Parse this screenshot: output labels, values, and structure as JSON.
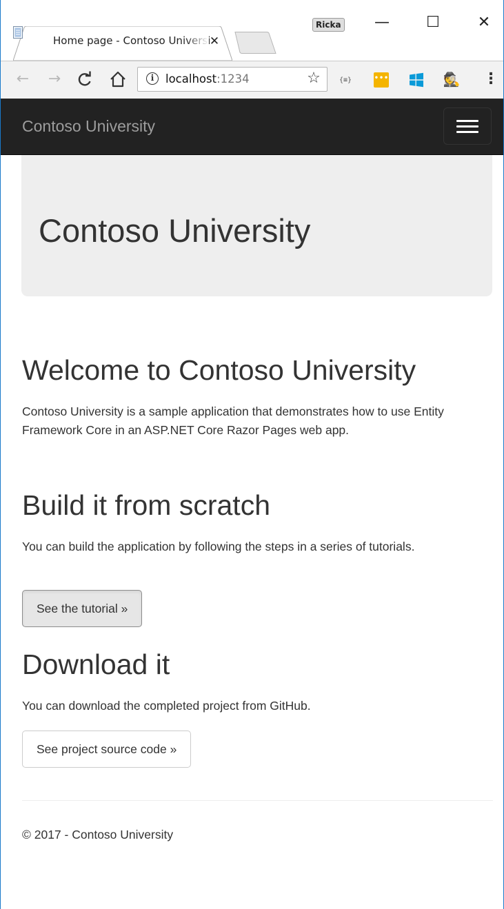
{
  "browser": {
    "tab_title": "Home page - Contoso University",
    "tab_close": "✕",
    "profile_name": "Ricka",
    "window_controls": {
      "minimize": "—",
      "maximize": "☐",
      "close": "✕"
    },
    "nav_icons": [
      "back-arrow-icon",
      "forward-arrow-icon",
      "reload-icon",
      "home-icon"
    ],
    "address": {
      "host": "localhost",
      "port": ":1234",
      "info_glyph": "i"
    },
    "extension_icons": [
      "json-viewer-icon",
      "password-manager-icon",
      "windows-icon",
      "incognito-spy-icon"
    ],
    "json_ext_label": "{≡}",
    "colors": {
      "window_border": "#1979ca",
      "toolbar": "#f2f2f2",
      "pass_ext": "#f4b400"
    }
  },
  "navbar": {
    "brand": "Contoso University",
    "toggle_icon": "hamburger-menu-icon",
    "colors": {
      "background": "#222222",
      "brand_text": "#9d9d9d"
    }
  },
  "jumbotron": {
    "title": "Contoso University",
    "colors": {
      "background": "#eeeeee"
    }
  },
  "sections": [
    {
      "heading": "Welcome to Contoso University",
      "text": "Contoso University is a sample application that demonstrates how to use Entity Framework Core in an ASP.NET Core Razor Pages web app."
    },
    {
      "heading": "Build it from scratch",
      "text": "You can build the application by following the steps in a series of tutorials.",
      "button": "See the tutorial »"
    },
    {
      "heading": "Download it",
      "text": "You can download the completed project from GitHub.",
      "button": "See project source code »"
    }
  ],
  "footer": {
    "text": "© 2017 - Contoso University"
  }
}
